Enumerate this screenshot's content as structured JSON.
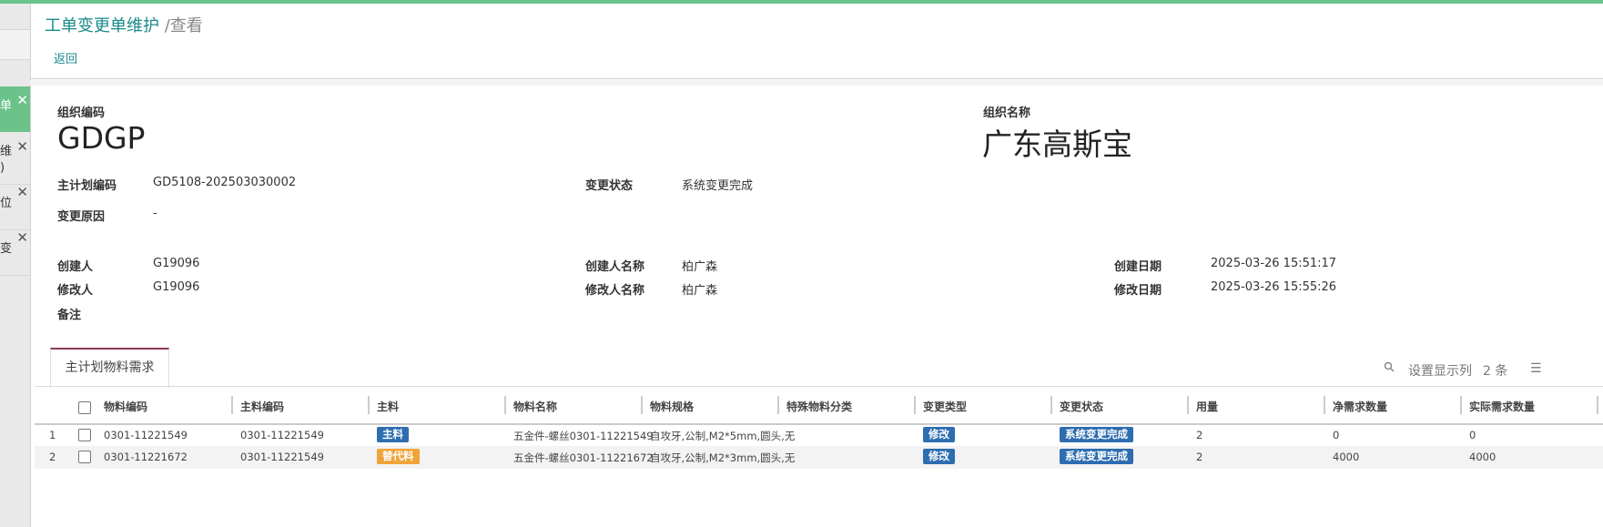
{
  "left_tabs": [
    "单",
    "维\n)",
    "位",
    "变"
  ],
  "breadcrumb": {
    "title": "工单变更单维护",
    "current": "/查看"
  },
  "back_label": "返回",
  "org": {
    "code_label": "组织编码",
    "code": "GDGP",
    "name_label": "组织名称",
    "name": "广东高斯宝"
  },
  "fields": {
    "plan_code_label": "主计划编码",
    "plan_code": "GD5108-202503030002",
    "change_status_label": "变更状态",
    "change_status": "系统变更完成",
    "reason_label": "变更原因",
    "reason": "-",
    "creator_label": "创建人",
    "creator": "G19096",
    "creator_name_label": "创建人名称",
    "creator_name": "柏广森",
    "create_date_label": "创建日期",
    "create_date": "2025-03-26 15:51:17",
    "modifier_label": "修改人",
    "modifier": "G19096",
    "modifier_name_label": "修改人名称",
    "modifier_name": "柏广森",
    "modify_date_label": "修改日期",
    "modify_date": "2025-03-26 15:55:26",
    "remark_label": "备注"
  },
  "tab_label": "主计划物料需求",
  "toolbar": {
    "columns_label": "设置显示列",
    "count": "2 条"
  },
  "columns": [
    "物料编码",
    "主料编码",
    "主料",
    "物料名称",
    "物料规格",
    "特殊物料分类",
    "变更类型",
    "变更状态",
    "用量",
    "净需求数量",
    "实际需求数量"
  ],
  "rows": [
    {
      "no": "1",
      "code": "0301-11221549",
      "main_code": "0301-11221549",
      "main": "主料",
      "name": "五金件-螺丝0301-11221549",
      "spec": "自攻牙,公制,M2*5mm,圆头,无",
      "special": "",
      "type": "修改",
      "status": "系统变更完成",
      "qty": "2",
      "net": "0",
      "actual": "0"
    },
    {
      "no": "2",
      "code": "0301-11221672",
      "main_code": "0301-11221549",
      "main": "替代料",
      "name": "五金件-螺丝0301-11221672",
      "spec": "自攻牙,公制,M2*3mm,圆头,无",
      "special": "",
      "type": "修改",
      "status": "系统变更完成",
      "qty": "2",
      "net": "4000",
      "actual": "4000"
    }
  ],
  "colors": {
    "accent": "#1a8a8a",
    "topbar": "#6cc38a",
    "tag_blue": "#2d6db0",
    "tag_orange": "#f0a33a"
  }
}
